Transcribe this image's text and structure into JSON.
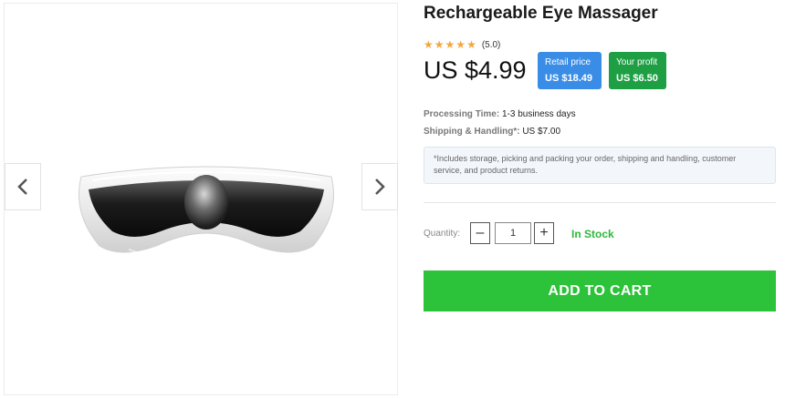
{
  "product": {
    "title": "Rechargeable Eye Massager",
    "rating": {
      "stars": 5,
      "label": "(5.0)"
    },
    "price": "US $4.99",
    "retail_badge": {
      "label": "Retail price",
      "value": "US $18.49"
    },
    "profit_badge": {
      "label": "Your profit",
      "value": "US $6.50"
    },
    "processing": {
      "label": "Processing Time:",
      "value": "1-3 business days"
    },
    "shipping": {
      "label": "Shipping & Handling*:",
      "value": "US $7.00"
    },
    "note": "*Includes storage, picking and packing your order, shipping and handling, customer service, and product returns.",
    "quantity": {
      "label": "Quantity:",
      "value": "1",
      "minus": "–",
      "plus": "+"
    },
    "stock_status": "In Stock",
    "add_to_cart_label": "ADD TO CART"
  },
  "gallery": {
    "prev_icon": "chevron-left-icon",
    "next_icon": "chevron-right-icon"
  },
  "colors": {
    "retail_badge": "#3a8de6",
    "profit_badge": "#1f9f44",
    "add_to_cart": "#2cc239",
    "in_stock": "#2db83a",
    "star": "#f2a640"
  }
}
